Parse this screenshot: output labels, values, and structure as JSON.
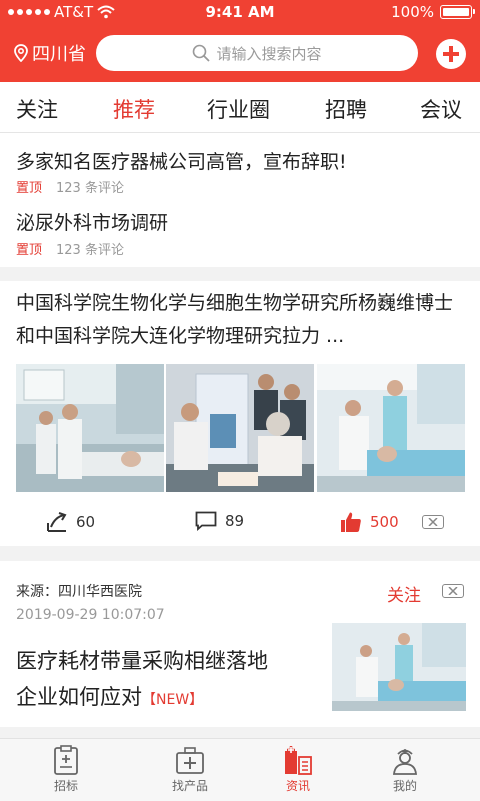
{
  "status_bar": {
    "carrier": "AT&T",
    "time": "9:41 AM",
    "battery": "100%"
  },
  "header": {
    "location": "四川省",
    "search_placeholder": "请输入搜索内容",
    "accent_color": "#f04133"
  },
  "tabs": [
    {
      "label": "关注",
      "active": false
    },
    {
      "label": "推荐",
      "active": true
    },
    {
      "label": "行业圈",
      "active": false
    },
    {
      "label": "招聘",
      "active": false
    },
    {
      "label": "会议",
      "active": false
    }
  ],
  "pinned_news": [
    {
      "title": "多家知名医疗器械公司高管，宣布辞职!",
      "tag": "置顶",
      "comments": "123 条评论"
    },
    {
      "title": "泌尿外科市场调研",
      "tag": "置顶",
      "comments": "123 条评论"
    }
  ],
  "gallery_post": {
    "title": "中国科学院生物化学与细胞生物学研究所杨巍维博士和中国科学院大连化学物理研究拉力 ...",
    "images": [
      "hospital-ward-photo",
      "exhibition-booth-photo",
      "dental-clinic-photo"
    ],
    "shares": "60",
    "comments": "89",
    "likes": "500"
  },
  "article": {
    "source": "来源：四川华西医院",
    "date": "2019-09-29  10:07:07",
    "follow_label": "关注",
    "title_line1": "医疗耗材带量采购相继落地",
    "title_line2": "企业如何应对",
    "new_badge": "【NEW】",
    "thumbnail": "dental-clinic-photo"
  },
  "bottom_nav": [
    {
      "label": "招标",
      "icon": "clipboard-icon",
      "active": false
    },
    {
      "label": "找产品",
      "icon": "medical-kit-icon",
      "active": false
    },
    {
      "label": "资讯",
      "icon": "hospital-building-icon",
      "active": true
    },
    {
      "label": "我的",
      "icon": "nurse-profile-icon",
      "active": false
    }
  ]
}
